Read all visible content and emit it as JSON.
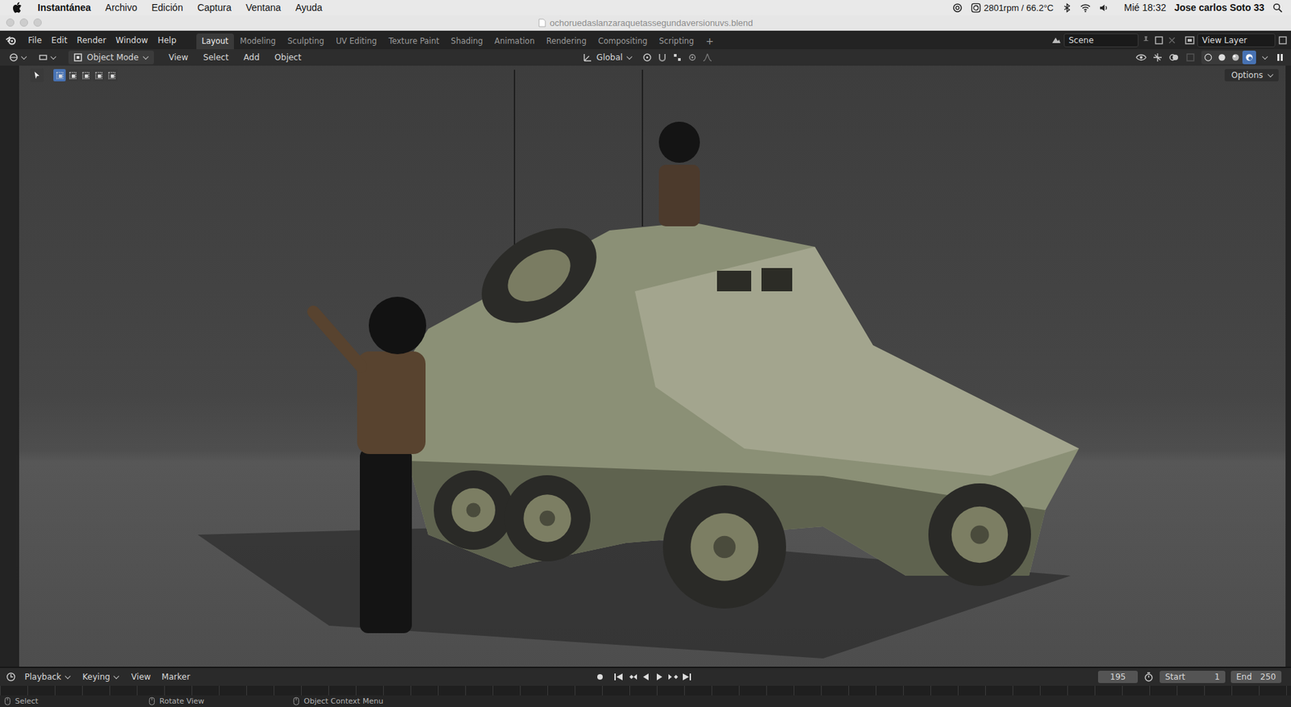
{
  "menubar": {
    "app": "Instantánea",
    "items": [
      "Archivo",
      "Edición",
      "Captura",
      "Ventana",
      "Ayuda"
    ],
    "status": "2801rpm / 66.2°C",
    "clock": "Mié 18:32",
    "user": "Jose carlos Soto 33"
  },
  "window": {
    "title": "ochoruedaslanzaraquetassegundaversionuvs.blend"
  },
  "topbar": {
    "menus": [
      "File",
      "Edit",
      "Render",
      "Window",
      "Help"
    ],
    "workspaces": [
      {
        "label": "Layout",
        "selected": true
      },
      {
        "label": "Modeling",
        "selected": false
      },
      {
        "label": "Sculpting",
        "selected": false
      },
      {
        "label": "UV Editing",
        "selected": false
      },
      {
        "label": "Texture Paint",
        "selected": false
      },
      {
        "label": "Shading",
        "selected": false
      },
      {
        "label": "Animation",
        "selected": false
      },
      {
        "label": "Rendering",
        "selected": false
      },
      {
        "label": "Compositing",
        "selected": false
      },
      {
        "label": "Scripting",
        "selected": false
      }
    ],
    "add": "+",
    "scene": "Scene",
    "view_layer": "View Layer"
  },
  "viewport_header": {
    "mode": "Object Mode",
    "menus": [
      "View",
      "Select",
      "Add",
      "Object"
    ],
    "orientation": "Global",
    "options": "Options"
  },
  "select_modes": [
    {
      "selected": true
    },
    {
      "selected": false
    },
    {
      "selected": false
    },
    {
      "selected": false
    },
    {
      "selected": false
    }
  ],
  "shading_modes": [
    {
      "selected": false
    },
    {
      "selected": false
    },
    {
      "selected": false
    },
    {
      "selected": true
    }
  ],
  "timeline": {
    "menus": [
      "Playback",
      "Keying",
      "View",
      "Marker"
    ],
    "frame": "195",
    "start_label": "Start",
    "start": "1",
    "end_label": "End",
    "end": "250"
  },
  "status_bar": [
    {
      "label": "Select"
    },
    {
      "label": "Rotate View"
    },
    {
      "label": "Object Context Menu"
    }
  ]
}
